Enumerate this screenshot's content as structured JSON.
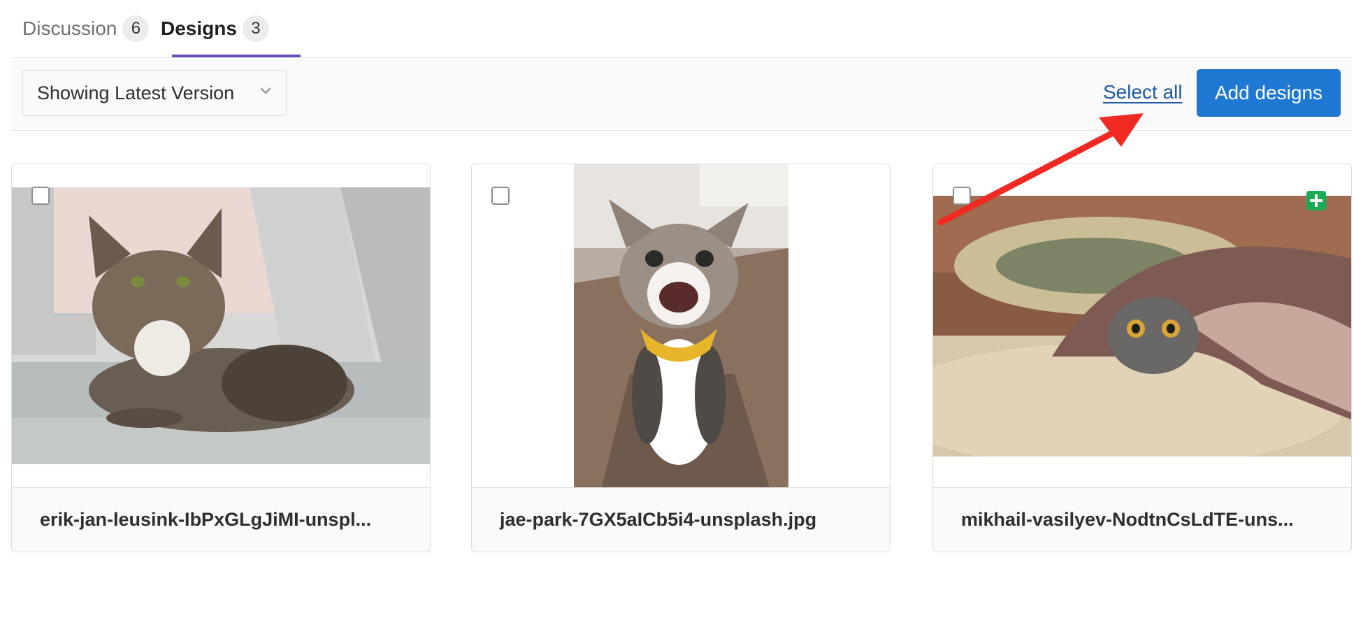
{
  "tabs": [
    {
      "label": "Discussion",
      "count": "6"
    },
    {
      "label": "Designs",
      "count": "3"
    }
  ],
  "toolbar": {
    "version_label": "Showing Latest Version",
    "select_all_label": "Select all",
    "add_designs_label": "Add designs"
  },
  "designs": [
    {
      "filename": "erik-jan-leusink-IbPxGLgJiMI-unspl..."
    },
    {
      "filename": "jae-park-7GX5aICb5i4-unsplash.jpg"
    },
    {
      "filename": "mikhail-vasilyev-NodtnCsLdTE-uns..."
    }
  ],
  "colors": {
    "accent_tab": "#6b4fbb",
    "primary_button": "#1f78d1",
    "link": "#1f5aa6",
    "new_badge": "#1aaa55",
    "annotation_arrow": "#f02a22"
  },
  "icons": {
    "version_dropdown": "chevron-down-icon",
    "new_design": "plus-square-icon",
    "annotation": "red-arrow-icon"
  }
}
